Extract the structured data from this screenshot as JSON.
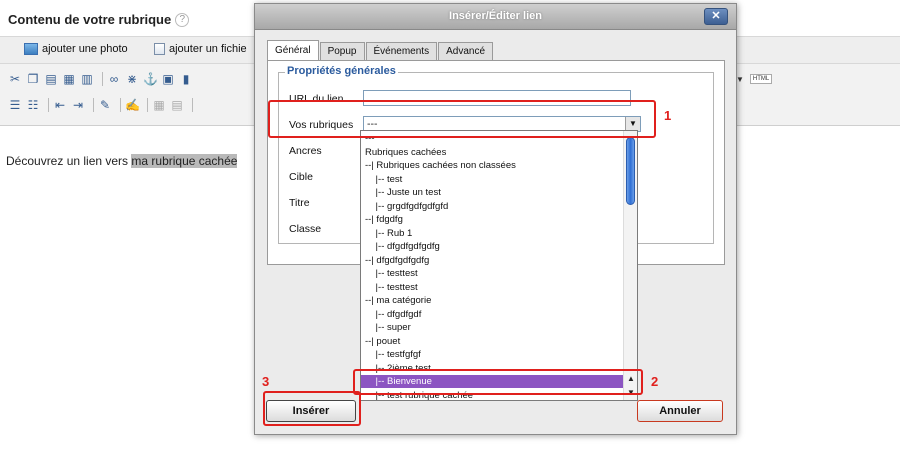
{
  "page": {
    "title": "Contenu de votre rubrique",
    "help_icon": "?",
    "insert_bar": {
      "add_photo": "ajouter une photo",
      "add_file": "ajouter un fichie"
    },
    "toolbar_right_html": "HTML",
    "content_prefix": "Découvrez un lien vers ",
    "content_highlight": "ma rubrique cachée"
  },
  "dialog": {
    "title": "Insérer/Éditer lien",
    "close_label": "✕",
    "tabs": [
      "Général",
      "Popup",
      "Événements",
      "Advancé"
    ],
    "legend": "Propriétés générales",
    "fields": {
      "url_label": "URL du lien",
      "rubriques_label": "Vos rubriques",
      "rubriques_value": "---",
      "ancres_label": "Ancres",
      "cible_label": "Cible",
      "titre_label": "Titre",
      "classe_label": "Classe"
    },
    "dropdown_items": [
      "---",
      "Rubriques cachées",
      "--| Rubriques cachées non classées",
      "    |-- test",
      "    |-- Juste un test",
      "    |-- grgdfgdfgdfgfd",
      "--| fdgdfg",
      "    |-- Rub 1",
      "    |-- dfgdfgdfgdfg",
      "--| dfgdfgdfgdfg",
      "    |-- testtest",
      "    |-- testtest",
      "--| ma catégorie",
      "    |-- dfgdfgdf",
      "    |-- super",
      "--| pouet",
      "    |-- testfgfgf",
      "    |-- 2ième test",
      "    |-- Bienvenue",
      "    |-- test rubrique cachée"
    ],
    "selected_item": "    |-- Bienvenue",
    "insert_button": "Insérer",
    "cancel_button": "Annuler"
  },
  "annotations": {
    "one": "1",
    "two": "2",
    "three": "3"
  },
  "colors": {
    "selection": "#8c55c2",
    "annotation_red": "#e0201d",
    "legend_blue": "#2b5b9e"
  }
}
